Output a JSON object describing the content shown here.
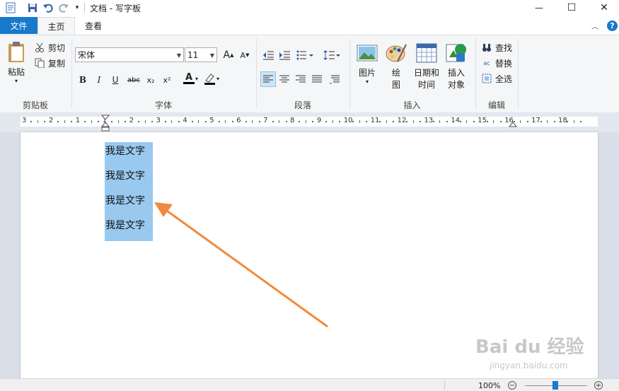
{
  "window": {
    "title": "文档 - 写字板",
    "controls": {
      "minimize": "—",
      "maximize": "☐",
      "close": "✕"
    }
  },
  "tabs": {
    "file": "文件",
    "home": "主页",
    "view": "查看"
  },
  "ribbon": {
    "clipboard": {
      "paste": "粘贴",
      "cut": "剪切",
      "copy": "复制",
      "group_label": "剪贴板"
    },
    "font": {
      "family": "宋体",
      "size": "11",
      "group_label": "字体",
      "bold": "B",
      "italic": "I",
      "underline": "U",
      "strike": "abc",
      "subscript": "x₂",
      "superscript": "x²",
      "font_color": "A",
      "grow": "A",
      "shrink": "A"
    },
    "paragraph": {
      "group_label": "段落"
    },
    "insert": {
      "picture": "图片",
      "draw_1": "绘",
      "draw_2": "图",
      "datetime_1": "日期和",
      "datetime_2": "时间",
      "object_1": "插入",
      "object_2": "对象",
      "group_label": "插入"
    },
    "editing": {
      "find": "查找",
      "replace": "替换",
      "select_all": "全选",
      "group_label": "编辑"
    }
  },
  "ruler": {
    "labels": [
      "3",
      "2",
      "1",
      "1",
      "2",
      "3",
      "4",
      "5",
      "6",
      "7",
      "8",
      "9",
      "10",
      "11",
      "12",
      "13",
      "14",
      "15",
      "16",
      "17",
      "18"
    ]
  },
  "document": {
    "lines": [
      "我是文字",
      "我是文字",
      "我是文字",
      "我是文字"
    ]
  },
  "watermark": {
    "main": "Bai du 经验",
    "sub": "jingyan.baidu.com"
  },
  "statusbar": {
    "zoom": "100%",
    "zoom_out": "−",
    "zoom_in": "+"
  },
  "colors": {
    "accent": "#1979ca",
    "selection": "#99c9ef",
    "arrow": "#f08a3c"
  }
}
